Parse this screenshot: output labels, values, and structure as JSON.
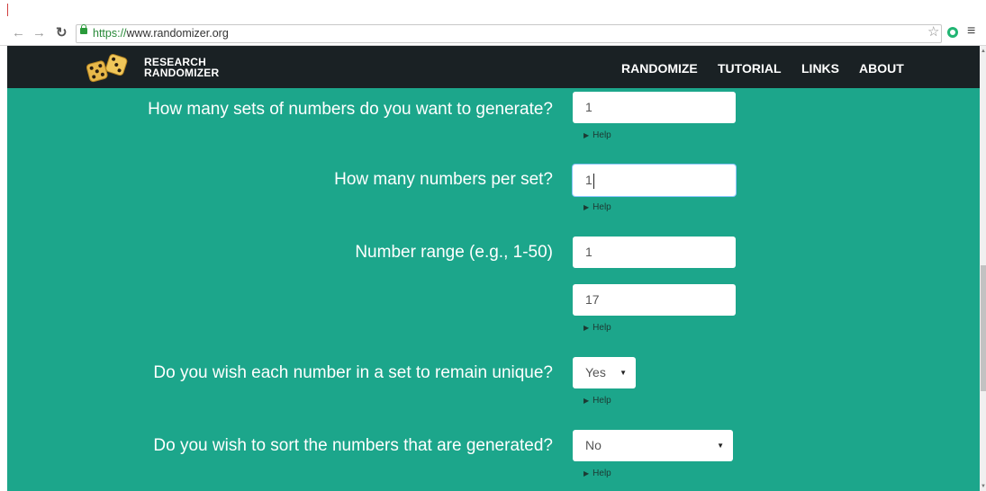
{
  "browser": {
    "url_scheme": "https://",
    "url_host": "www.randomizer.org",
    "back_icon": "arrow-left",
    "forward_icon": "arrow-right",
    "reload_icon": "reload",
    "bookmark_icon": "star",
    "extension_icon": "green-circle",
    "menu_icon": "hamburger"
  },
  "site": {
    "logo_line1": "RESEARCH",
    "logo_line2": "RANDOMIZER",
    "nav": [
      "RANDOMIZE",
      "TUTORIAL",
      "LINKS",
      "ABOUT"
    ],
    "colors": {
      "header_bg": "#1a2124",
      "page_bg": "#1ca68b",
      "dice": "#e8b84a"
    }
  },
  "form": {
    "sets_question": "How many sets of numbers do you want to generate?",
    "sets_value": "1",
    "per_set_question": "How many numbers per set?",
    "per_set_value": "1",
    "range_question": "Number range (e.g., 1-50)",
    "range_from": "1",
    "range_to": "17",
    "unique_question": "Do you wish each number in a set to remain unique?",
    "unique_value": "Yes",
    "sort_question": "Do you wish to sort the numbers that are generated?",
    "sort_value": "No",
    "help_label": "Help"
  }
}
